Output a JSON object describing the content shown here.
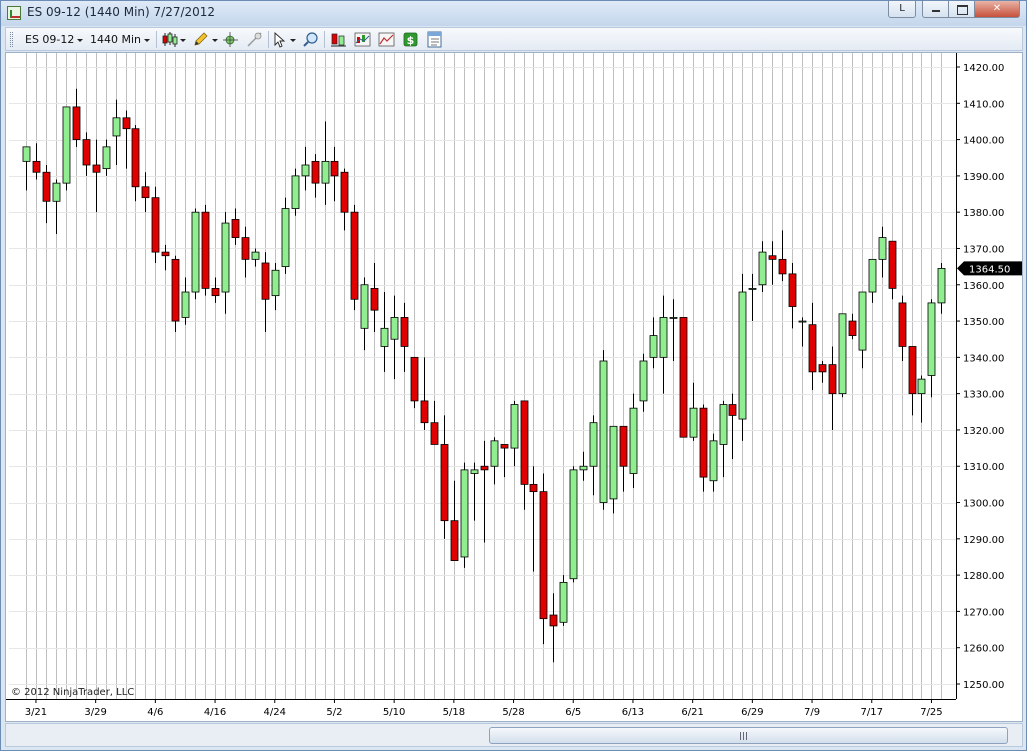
{
  "window": {
    "title": "ES 09-12 (1440 Min)  7/27/2012",
    "caption_l": "L",
    "caption_close": "✕"
  },
  "toolbar": {
    "instrument": "ES 09-12",
    "interval": "1440 Min"
  },
  "colors": {
    "up": "#90ee90",
    "down": "#e00000",
    "grid": "#bfbfbf",
    "last_price_bg": "#000000"
  },
  "copyright": "© 2012 NinjaTrader, LLC",
  "chart_data": {
    "type": "candlestick",
    "y_ticks": [
      "1420.00",
      "1410.00",
      "1400.00",
      "1390.00",
      "1380.00",
      "1370.00",
      "1360.00",
      "1350.00",
      "1340.00",
      "1330.00",
      "1320.00",
      "1310.00",
      "1300.00",
      "1290.00",
      "1280.00",
      "1270.00",
      "1260.00",
      "1250.00"
    ],
    "ylim": [
      1245.5,
      1423
    ],
    "x_labels": [
      {
        "label": "3/21",
        "index": 1
      },
      {
        "label": "3/29",
        "index": 7
      },
      {
        "label": "4/6",
        "index": 13
      },
      {
        "label": "4/16",
        "index": 19
      },
      {
        "label": "4/24",
        "index": 25
      },
      {
        "label": "5/2",
        "index": 31
      },
      {
        "label": "5/10",
        "index": 37
      },
      {
        "label": "5/18",
        "index": 43
      },
      {
        "label": "5/28",
        "index": 49
      },
      {
        "label": "6/5",
        "index": 55
      },
      {
        "label": "6/13",
        "index": 61
      },
      {
        "label": "6/21",
        "index": 67
      },
      {
        "label": "6/29",
        "index": 73
      },
      {
        "label": "7/9",
        "index": 79
      },
      {
        "label": "7/17",
        "index": 85
      },
      {
        "label": "7/25",
        "index": 91
      }
    ],
    "last_price": "1364.50",
    "candles": [
      [
        1394,
        1398,
        1386,
        1398
      ],
      [
        1394,
        1399,
        1389,
        1391
      ],
      [
        1391,
        1393,
        1377,
        1383
      ],
      [
        1383,
        1389,
        1374,
        1388
      ],
      [
        1388,
        1409,
        1386,
        1409
      ],
      [
        1409,
        1414,
        1398,
        1400
      ],
      [
        1400,
        1402,
        1390,
        1393
      ],
      [
        1393,
        1400,
        1380,
        1391
      ],
      [
        1392,
        1400,
        1390,
        1398
      ],
      [
        1401,
        1411,
        1393,
        1406
      ],
      [
        1406,
        1408,
        1392,
        1403
      ],
      [
        1403,
        1404,
        1383,
        1387
      ],
      [
        1387,
        1391,
        1380,
        1384
      ],
      [
        1384,
        1387,
        1366,
        1369
      ],
      [
        1369,
        1371,
        1364,
        1368
      ],
      [
        1367,
        1368,
        1347,
        1350
      ],
      [
        1351,
        1362,
        1349,
        1358
      ],
      [
        1358,
        1381,
        1356,
        1380
      ],
      [
        1380,
        1382,
        1357,
        1359
      ],
      [
        1359,
        1362,
        1355,
        1357
      ],
      [
        1358,
        1380,
        1352,
        1377
      ],
      [
        1378,
        1381,
        1371,
        1373
      ],
      [
        1373,
        1376,
        1362,
        1367
      ],
      [
        1367,
        1370,
        1365,
        1369
      ],
      [
        1366,
        1369,
        1347,
        1356
      ],
      [
        1357,
        1366,
        1353,
        1364
      ],
      [
        1365,
        1384,
        1363,
        1381
      ],
      [
        1381,
        1392,
        1379,
        1390
      ],
      [
        1390,
        1398,
        1386,
        1393
      ],
      [
        1394,
        1396,
        1384,
        1388
      ],
      [
        1388,
        1405,
        1382,
        1394
      ],
      [
        1394,
        1398,
        1383,
        1390
      ],
      [
        1391,
        1392,
        1375,
        1380
      ],
      [
        1380,
        1382,
        1353,
        1356
      ],
      [
        1348,
        1362,
        1342,
        1360
      ],
      [
        1359,
        1366,
        1347,
        1353
      ],
      [
        1343,
        1358,
        1336,
        1348
      ],
      [
        1345,
        1357,
        1334,
        1351
      ],
      [
        1351,
        1355,
        1336,
        1343
      ],
      [
        1340,
        1340,
        1326,
        1328
      ],
      [
        1328,
        1340,
        1320,
        1322
      ],
      [
        1322,
        1328,
        1316,
        1316
      ],
      [
        1316,
        1324,
        1290,
        1295
      ],
      [
        1295,
        1306,
        1284,
        1284
      ],
      [
        1285,
        1311,
        1282,
        1309
      ],
      [
        1308,
        1311,
        1295,
        1309
      ],
      [
        1310,
        1317,
        1289,
        1309
      ],
      [
        1310,
        1318,
        1305,
        1317
      ],
      [
        1316,
        1315,
        1307,
        1315
      ],
      [
        1315,
        1328,
        1310,
        1327
      ],
      [
        1328,
        1328,
        1298,
        1305
      ],
      [
        1305,
        1310,
        1281,
        1303
      ],
      [
        1303,
        1308,
        1261,
        1268
      ],
      [
        1269,
        1275,
        1256,
        1266
      ],
      [
        1267,
        1280,
        1266,
        1278
      ],
      [
        1279,
        1310,
        1278,
        1309
      ],
      [
        1309,
        1314,
        1306,
        1310
      ],
      [
        1310,
        1324,
        1302,
        1322
      ],
      [
        1300,
        1342,
        1298,
        1339
      ],
      [
        1301,
        1320,
        1297,
        1321
      ],
      [
        1321,
        1320,
        1303,
        1310
      ],
      [
        1308,
        1330,
        1304,
        1326
      ],
      [
        1328,
        1341,
        1325,
        1339
      ],
      [
        1340,
        1351,
        1337,
        1346
      ],
      [
        1340,
        1357,
        1330,
        1351
      ],
      [
        1351,
        1356,
        1339,
        1351
      ],
      [
        1351,
        1351,
        1318,
        1318
      ],
      [
        1318,
        1333,
        1317,
        1326
      ],
      [
        1326,
        1327,
        1303,
        1307
      ],
      [
        1306,
        1319,
        1303,
        1317
      ],
      [
        1316,
        1328,
        1307,
        1327
      ],
      [
        1327,
        1330,
        1312,
        1324
      ],
      [
        1323,
        1363,
        1317,
        1358
      ],
      [
        1359,
        1363,
        1350,
        1359
      ],
      [
        1360,
        1372,
        1358,
        1369
      ],
      [
        1368,
        1372,
        1360,
        1367
      ],
      [
        1367,
        1375,
        1361,
        1363
      ],
      [
        1363,
        1366,
        1348,
        1354
      ],
      [
        1350,
        1351,
        1343,
        1350
      ],
      [
        1349,
        1355,
        1331,
        1336
      ],
      [
        1338,
        1339,
        1333,
        1336
      ],
      [
        1338,
        1343,
        1320,
        1330
      ],
      [
        1330,
        1352,
        1329,
        1352
      ],
      [
        1350,
        1352,
        1345,
        1346
      ],
      [
        1342,
        1356,
        1337,
        1358
      ],
      [
        1358,
        1367,
        1355,
        1367
      ],
      [
        1367,
        1376,
        1362,
        1373
      ],
      [
        1372,
        1372,
        1356,
        1359
      ],
      [
        1355,
        1357,
        1339,
        1343
      ],
      [
        1343,
        1343,
        1324,
        1330
      ],
      [
        1330,
        1335,
        1322,
        1334
      ],
      [
        1335,
        1356,
        1329,
        1355
      ],
      [
        1355,
        1366,
        1352,
        1364.5
      ]
    ]
  }
}
